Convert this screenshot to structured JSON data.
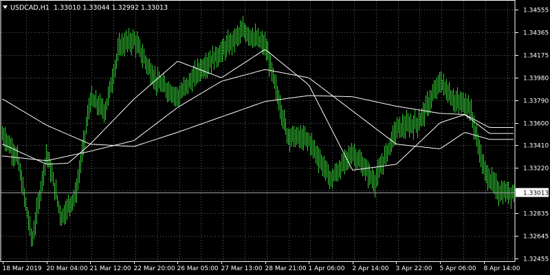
{
  "header": {
    "symbol": "USDCAD,H1",
    "quotes": "1.33010 1.33044 1.32992 1.33013",
    "menu_icon": "triangle-down-icon"
  },
  "colors": {
    "background": "#000000",
    "candles": "#33cc33",
    "moving_averages": "#ffffff",
    "grid": "#6a6a6a",
    "price_line": "#a0a0a0",
    "current_price_box": "#ffffff"
  },
  "chart_data": {
    "type": "line",
    "symbol": "USDCAD",
    "timeframe": "H1",
    "ylim": [
      1.32455,
      1.34555
    ],
    "y_ticks": [
      "1.34555",
      "1.34365",
      "1.34175",
      "1.33980",
      "1.33790",
      "1.33600",
      "1.33410",
      "1.33220",
      "1.33030",
      "1.32835",
      "1.32645",
      "1.32455"
    ],
    "x_ticks": [
      "18 Mar 2019",
      "20 Mar 04:00",
      "21 Mar 12:00",
      "22 Mar 20:00",
      "26 Mar 05:00",
      "27 Mar 13:00",
      "28 Mar 21:00",
      "1 Apr 06:00",
      "2 Apr 14:00",
      "3 Apr 22:00",
      "5 Apr 06:00",
      "8 Apr 14:00"
    ],
    "grid": true,
    "current_price": "1.33013",
    "price_series": [
      {
        "x": "18 Mar 2019",
        "y": 1.335
      },
      {
        "x": "19 Mar 06:00",
        "y": 1.333
      },
      {
        "x": "19 Mar 16:00",
        "y": 1.326
      },
      {
        "x": "20 Mar 04:00",
        "y": 1.3335
      },
      {
        "x": "20 Mar 14:00",
        "y": 1.328
      },
      {
        "x": "21 Mar 00:00",
        "y": 1.33
      },
      {
        "x": "21 Mar 12:00",
        "y": 1.338
      },
      {
        "x": "22 Mar 02:00",
        "y": 1.337
      },
      {
        "x": "22 Mar 12:00",
        "y": 1.3425
      },
      {
        "x": "22 Mar 20:00",
        "y": 1.343
      },
      {
        "x": "25 Mar 10:00",
        "y": 1.3395
      },
      {
        "x": "26 Mar 05:00",
        "y": 1.3382
      },
      {
        "x": "26 Mar 20:00",
        "y": 1.3405
      },
      {
        "x": "27 Mar 13:00",
        "y": 1.342
      },
      {
        "x": "28 Mar 04:00",
        "y": 1.3438
      },
      {
        "x": "28 Mar 21:00",
        "y": 1.3425
      },
      {
        "x": "29 Mar 10:00",
        "y": 1.335
      },
      {
        "x": "1 Apr 06:00",
        "y": 1.3345
      },
      {
        "x": "1 Apr 18:00",
        "y": 1.3312
      },
      {
        "x": "2 Apr 14:00",
        "y": 1.3335
      },
      {
        "x": "3 Apr 08:00",
        "y": 1.331
      },
      {
        "x": "3 Apr 22:00",
        "y": 1.3355
      },
      {
        "x": "4 Apr 14:00",
        "y": 1.336
      },
      {
        "x": "5 Apr 06:00",
        "y": 1.3395
      },
      {
        "x": "5 Apr 16:00",
        "y": 1.3378
      },
      {
        "x": "8 Apr 06:00",
        "y": 1.3375
      },
      {
        "x": "8 Apr 14:00",
        "y": 1.332
      },
      {
        "x": "9 Apr 00:00",
        "y": 1.33013
      }
    ],
    "moving_averages": [
      {
        "values": [
          {
            "x": "18 Mar 2019",
            "y": 1.3342
          },
          {
            "x": "20 Mar 04:00",
            "y": 1.3325
          },
          {
            "x": "21 Mar 00:00",
            "y": 1.3326
          },
          {
            "x": "21 Mar 12:00",
            "y": 1.3342
          },
          {
            "x": "22 Mar 20:00",
            "y": 1.338
          },
          {
            "x": "26 Mar 05:00",
            "y": 1.3412
          },
          {
            "x": "27 Mar 13:00",
            "y": 1.3398
          },
          {
            "x": "28 Mar 21:00",
            "y": 1.3422
          },
          {
            "x": "1 Apr 06:00",
            "y": 1.3392
          },
          {
            "x": "2 Apr 14:00",
            "y": 1.332
          },
          {
            "x": "3 Apr 22:00",
            "y": 1.3325
          },
          {
            "x": "5 Apr 06:00",
            "y": 1.336
          },
          {
            "x": "8 Apr 06:00",
            "y": 1.3367
          },
          {
            "x": "9 Apr 00:00",
            "y": 1.3351
          }
        ]
      },
      {
        "values": [
          {
            "x": "18 Mar 2019",
            "y": 1.3332
          },
          {
            "x": "20 Mar 04:00",
            "y": 1.3328
          },
          {
            "x": "21 Mar 12:00",
            "y": 1.3336
          },
          {
            "x": "22 Mar 20:00",
            "y": 1.3345
          },
          {
            "x": "26 Mar 05:00",
            "y": 1.3373
          },
          {
            "x": "27 Mar 13:00",
            "y": 1.3395
          },
          {
            "x": "28 Mar 21:00",
            "y": 1.3405
          },
          {
            "x": "1 Apr 06:00",
            "y": 1.3398
          },
          {
            "x": "2 Apr 14:00",
            "y": 1.337
          },
          {
            "x": "3 Apr 22:00",
            "y": 1.3342
          },
          {
            "x": "5 Apr 06:00",
            "y": 1.3338
          },
          {
            "x": "8 Apr 06:00",
            "y": 1.3352
          },
          {
            "x": "9 Apr 00:00",
            "y": 1.3346
          }
        ]
      },
      {
        "values": [
          {
            "x": "18 Mar 2019",
            "y": 1.338
          },
          {
            "x": "20 Mar 04:00",
            "y": 1.3358
          },
          {
            "x": "21 Mar 12:00",
            "y": 1.3342
          },
          {
            "x": "22 Mar 20:00",
            "y": 1.334
          },
          {
            "x": "26 Mar 05:00",
            "y": 1.3352
          },
          {
            "x": "27 Mar 13:00",
            "y": 1.3365
          },
          {
            "x": "28 Mar 21:00",
            "y": 1.3378
          },
          {
            "x": "1 Apr 06:00",
            "y": 1.3383
          },
          {
            "x": "2 Apr 14:00",
            "y": 1.3382
          },
          {
            "x": "3 Apr 22:00",
            "y": 1.3374
          },
          {
            "x": "5 Apr 06:00",
            "y": 1.3368
          },
          {
            "x": "8 Apr 06:00",
            "y": 1.3367
          },
          {
            "x": "9 Apr 00:00",
            "y": 1.3356
          }
        ]
      }
    ]
  }
}
